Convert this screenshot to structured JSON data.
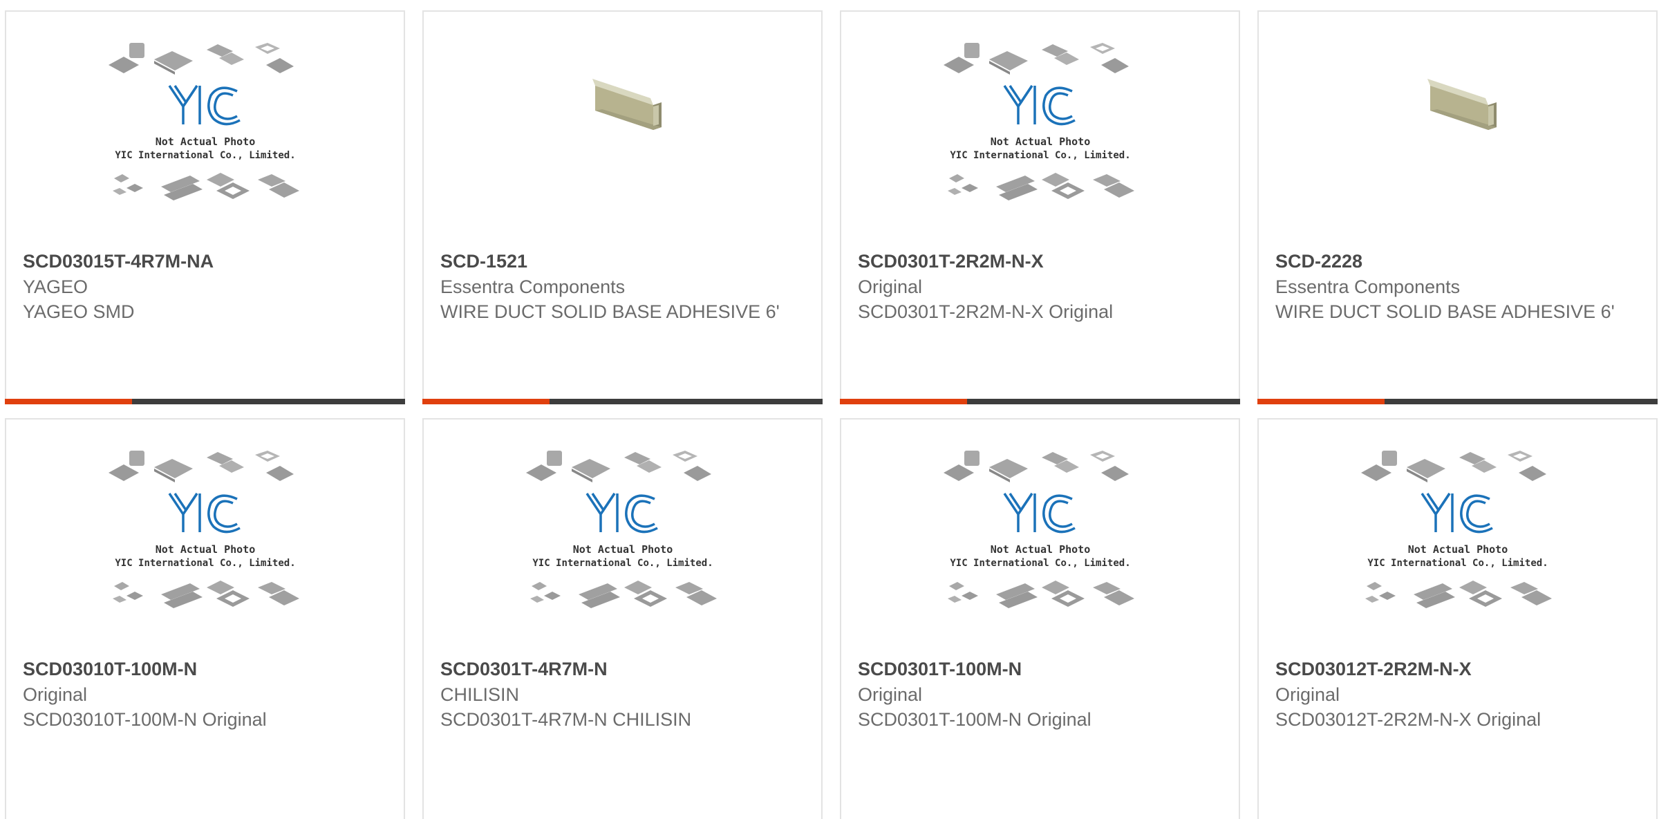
{
  "colors": {
    "accent": "#e0400e",
    "bar": "#3d3d3d",
    "border": "#e3e3e3",
    "brand_blue": "#1b72b9"
  },
  "placeholder": {
    "line1": "Not Actual Photo",
    "line2": "YIC International Co., Limited."
  },
  "products": [
    {
      "part_number": "SCD03015T-4R7M-NA",
      "manufacturer": "YAGEO",
      "description": "YAGEO SMD",
      "image": "yic-placeholder"
    },
    {
      "part_number": "SCD-1521",
      "manufacturer": "Essentra Components",
      "description": "WIRE DUCT SOLID BASE ADHESIVE 6'",
      "image": "wire-duct"
    },
    {
      "part_number": "SCD0301T-2R2M-N-X",
      "manufacturer": "Original",
      "description": "SCD0301T-2R2M-N-X Original",
      "image": "yic-placeholder"
    },
    {
      "part_number": "SCD-2228",
      "manufacturer": "Essentra Components",
      "description": "WIRE DUCT SOLID BASE ADHESIVE 6'",
      "image": "wire-duct"
    },
    {
      "part_number": "SCD03010T-100M-N",
      "manufacturer": "Original",
      "description": "SCD03010T-100M-N Original",
      "image": "yic-placeholder"
    },
    {
      "part_number": "SCD0301T-4R7M-N",
      "manufacturer": "CHILISIN",
      "description": "SCD0301T-4R7M-N CHILISIN",
      "image": "yic-placeholder"
    },
    {
      "part_number": "SCD0301T-100M-N",
      "manufacturer": "Original",
      "description": "SCD0301T-100M-N Original",
      "image": "yic-placeholder"
    },
    {
      "part_number": "SCD03012T-2R2M-N-X",
      "manufacturer": "Original",
      "description": "SCD03012T-2R2M-N-X Original",
      "image": "yic-placeholder"
    }
  ]
}
